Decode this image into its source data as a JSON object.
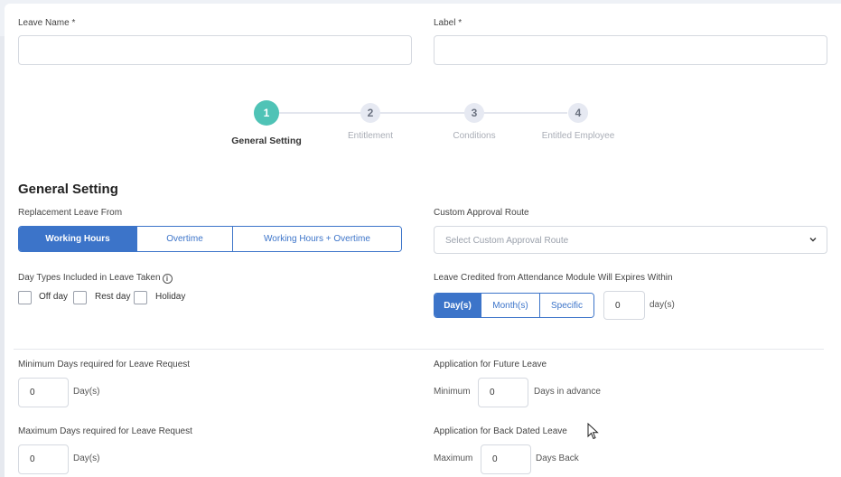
{
  "fields": {
    "leave_name_label": "Leave Name *",
    "label_label": "Label *"
  },
  "stepper": {
    "steps": [
      {
        "number": "1",
        "label": "General Setting",
        "active": true
      },
      {
        "number": "2",
        "label": "Entitlement",
        "active": false
      },
      {
        "number": "3",
        "label": "Conditions",
        "active": false
      },
      {
        "number": "4",
        "label": "Entitled Employee",
        "active": false
      }
    ]
  },
  "section_title": "General Setting",
  "replacement": {
    "label": "Replacement Leave From",
    "options": [
      "Working Hours",
      "Overtime",
      "Working Hours + Overtime"
    ],
    "selected": "Working Hours"
  },
  "approval": {
    "label": "Custom Approval Route",
    "placeholder": "Select Custom Approval Route"
  },
  "day_types": {
    "label": "Day Types Included in Leave Taken",
    "info_glyph": "i",
    "options": [
      "Off day",
      "Rest day",
      "Holiday"
    ]
  },
  "credited": {
    "label": "Leave Credited from Attendance Module Will Expires Within",
    "options": [
      "Day(s)",
      "Month(s)",
      "Specific"
    ],
    "selected": "Day(s)",
    "value": "0",
    "unit": "day(s)"
  },
  "min_days": {
    "label": "Minimum Days required for Leave Request",
    "value": "0",
    "unit": "Day(s)"
  },
  "future_leave": {
    "label": "Application for Future Leave",
    "prefix": "Minimum",
    "value": "0",
    "suffix": "Days in advance"
  },
  "max_days": {
    "label": "Maximum Days required for Leave Request",
    "value": "0",
    "unit": "Day(s)"
  },
  "back_dated": {
    "label": "Application for Back Dated Leave",
    "prefix": "Maximum",
    "value": "0",
    "suffix": "Days Back"
  },
  "colors": {
    "primary": "#3c74c9",
    "step_active": "#4fc3b6"
  }
}
